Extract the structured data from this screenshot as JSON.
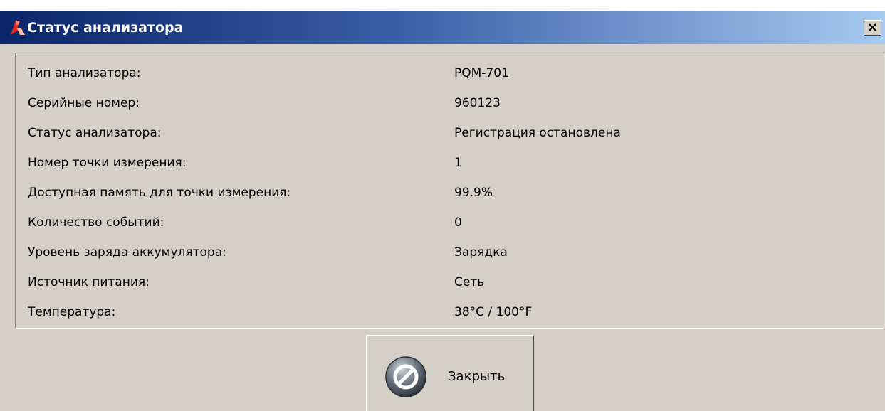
{
  "window": {
    "title": "Статус анализатора",
    "close_symbol": "×",
    "icons": {
      "app": "app-logo-icon",
      "close": "close-icon"
    },
    "colors": {
      "title_start": "#0a246a",
      "title_end": "#a6caf0",
      "face": "#d4d0c8"
    }
  },
  "status": {
    "rows": [
      {
        "label": "Тип анализатора:",
        "value": "PQM-701"
      },
      {
        "label": "Серийные номер:",
        "value": "960123"
      },
      {
        "label": "Статус анализатора:",
        "value": "Регистрация остановлена"
      },
      {
        "label": "Номер точки измерения:",
        "value": "1"
      },
      {
        "label": "Доступная память для точки измерения:",
        "value": "99.9%"
      },
      {
        "label": "Количество событий:",
        "value": "0"
      },
      {
        "label": "Уровень заряда аккумулятора:",
        "value": "Зарядка"
      },
      {
        "label": "Источник питания:",
        "value": "Сеть"
      },
      {
        "label": "Температура:",
        "value": "38°C / 100°F"
      }
    ]
  },
  "actions": {
    "close_label": "Закрыть",
    "close_icon": "cancel-icon"
  }
}
